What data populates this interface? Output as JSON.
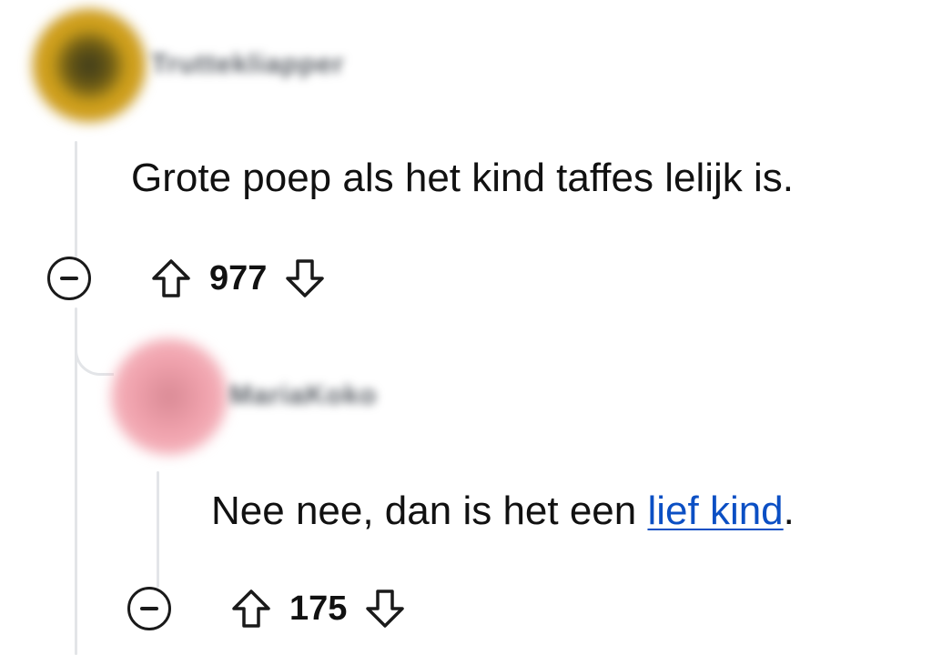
{
  "comments": [
    {
      "username": "Truttekliapper",
      "text": "Grote poep als het kind taffes lelijk is.",
      "score": "977"
    },
    {
      "username": "MariaKoko",
      "text_before": "Nee nee, dan is het een ",
      "link_text": "lief kind",
      "text_after": ".",
      "score": "175"
    }
  ],
  "icons": {
    "collapse": "minus-circle-icon",
    "upvote": "arrow-up-icon",
    "downvote": "arrow-down-icon"
  },
  "colors": {
    "link": "#0b4fc4",
    "thread_line": "#e3e5e8"
  }
}
